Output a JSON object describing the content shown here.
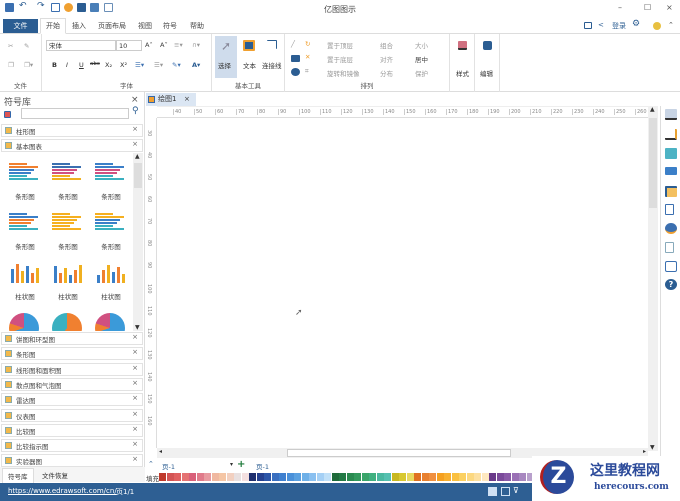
{
  "window": {
    "title": "亿图图示",
    "minimize": "–",
    "maximize": "☐",
    "close": "×"
  },
  "tabs": {
    "file": "文件",
    "items": [
      "开始",
      "插入",
      "页面布局",
      "视图",
      "符号",
      "帮助"
    ],
    "login": "登录"
  },
  "ribbon": {
    "groups": {
      "file": "文件",
      "font": "字体",
      "basic_tools": "基本工具",
      "arrange": "排列"
    },
    "font_name": "宋体",
    "font_size": "10",
    "select": "选择",
    "text": "文本",
    "connector": "连接线",
    "arrange_items": [
      "置于顶层",
      "置于底层",
      "旋转和镜像",
      "组合",
      "对齐",
      "分布",
      "大小",
      "居中",
      "保护"
    ],
    "style": "样式",
    "edit": "编辑",
    "format_buttons": [
      "B",
      "I",
      "U",
      "abc",
      "X₂",
      "X²"
    ]
  },
  "library": {
    "title": "符号库",
    "search_placeholder": "",
    "open_categories": [
      "柱形图",
      "基本图表"
    ],
    "shapes": [
      "条形图",
      "条形图",
      "条形图",
      "条形图",
      "条形图",
      "条形图",
      "柱状图",
      "柱状图",
      "柱状图"
    ],
    "categories": [
      "饼图和环型图",
      "条形图",
      "线形图和面积图",
      "散点图和气泡图",
      "雷达图",
      "仪表图",
      "比较图",
      "比较指示图",
      "实验器图"
    ],
    "bottom_tabs": [
      "符号库",
      "文件恢复"
    ]
  },
  "document": {
    "tab": "绘图1",
    "ruler_top": [
      "40",
      "50",
      "60",
      "70",
      "80",
      "90",
      "100",
      "110",
      "120",
      "130",
      "140",
      "150",
      "160",
      "170",
      "180",
      "190",
      "200",
      "210",
      "220",
      "230",
      "240",
      "250",
      "260"
    ],
    "ruler_left": [
      "30",
      "40",
      "50",
      "60",
      "70",
      "80",
      "90",
      "100",
      "110",
      "120",
      "130",
      "140",
      "150",
      "160"
    ]
  },
  "pagebar": {
    "page_select": "页-1",
    "page_tab": "页-1",
    "fill_label": "填充"
  },
  "palette": [
    "#c0392b",
    "#d35454",
    "#e06060",
    "#e57373",
    "#d9607a",
    "#e07a8a",
    "#e89aa0",
    "#f0b8a0",
    "#f5c6a5",
    "#f2d0c0",
    "#e8e0e0",
    "#f4e0e0",
    "#1f2f6e",
    "#25408f",
    "#2c55a8",
    "#3a6fc0",
    "#3f80cf",
    "#4a90d9",
    "#5aa0e0",
    "#6eb0e8",
    "#8ac0f0",
    "#a5d0f5",
    "#c0e0f8",
    "#1e6b3a",
    "#237a45",
    "#2a8a50",
    "#33995c",
    "#3aa56a",
    "#40b080",
    "#4ab8a0",
    "#55c0b0",
    "#c8b820",
    "#d8c830",
    "#e8d860",
    "#e07020",
    "#e88030",
    "#f09040",
    "#f5a020",
    "#f8b030",
    "#fac040",
    "#fbd060",
    "#fcd880",
    "#fde0a0",
    "#fee8c0",
    "#6a3a8a",
    "#7a4a9a",
    "#8a5aa8",
    "#9a70b5",
    "#a888c0",
    "#b8a0cc",
    "#c8b8d8",
    "#8a1a1a",
    "#a02020"
  ],
  "status": {
    "url": "https://www.edrawsoft.com/cn/",
    "page": "页1/1"
  },
  "watermark": {
    "name": "这里教程网",
    "url": "herecours.com"
  }
}
